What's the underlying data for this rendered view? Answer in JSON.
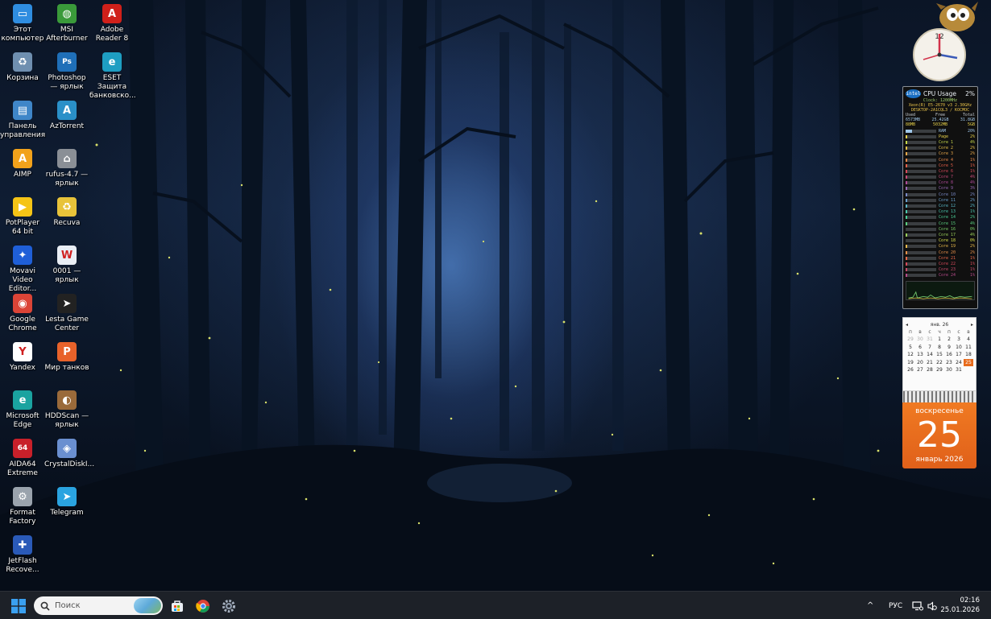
{
  "desktop": {
    "col1": [
      {
        "label": "Этот компьютер",
        "icon": "computer-icon",
        "color": "#2f8de0"
      },
      {
        "label": "Корзина",
        "icon": "recycle-bin-icon",
        "color": "#6f8fb0"
      },
      {
        "label": "Панель управления",
        "icon": "control-panel-icon",
        "color": "#3f86c8"
      },
      {
        "label": "AIMP",
        "icon": "aimp-icon",
        "color": "#f2a21b"
      },
      {
        "label": "PotPlayer 64 bit",
        "icon": "potplayer-icon",
        "color": "#f5c416"
      },
      {
        "label": "Movavi Video Editor...",
        "icon": "movavi-icon",
        "color": "#1f5fd8"
      },
      {
        "label": "Google Chrome",
        "icon": "chrome-icon",
        "color": "#db4437"
      },
      {
        "label": "Yandex",
        "icon": "yandex-icon",
        "color": "#ffffff"
      },
      {
        "label": "Microsoft Edge",
        "icon": "edge-icon",
        "color": "#1aa3a0"
      },
      {
        "label": "AIDA64 Extreme",
        "icon": "aida64-icon",
        "color": "#c8202a"
      },
      {
        "label": "Format Factory",
        "icon": "format-factory-icon",
        "color": "#9aa3ad"
      },
      {
        "label": "JetFlash Recove...",
        "icon": "jetflash-icon",
        "color": "#2a5ab8"
      }
    ],
    "col2": [
      {
        "label": "MSI Afterburner",
        "icon": "msi-afterburner-icon",
        "color": "#3a9a3a"
      },
      {
        "label": "Photoshop — ярлык",
        "icon": "photoshop-icon",
        "color": "#1f6fb8"
      },
      {
        "label": "AzTorrent",
        "icon": "aztorrent-icon",
        "color": "#2a90c8"
      },
      {
        "label": "rufus-4.7 — ярлык",
        "icon": "rufus-icon",
        "color": "#8a8f96"
      },
      {
        "label": "Recuva",
        "icon": "recuva-icon",
        "color": "#e8c33a"
      },
      {
        "label": "0001 — ярлык",
        "icon": "word-document-icon",
        "color": "#e9eef5"
      },
      {
        "label": "Lesta Game Center",
        "icon": "lesta-icon",
        "color": "#222222"
      },
      {
        "label": "Мир танков",
        "icon": "mir-tankov-icon",
        "color": "#e8622a"
      },
      {
        "label": "HDDScan — ярлык",
        "icon": "hddscan-icon",
        "color": "#9a6a3a"
      },
      {
        "label": "CrystalDiskI...",
        "icon": "crystaldisk-icon",
        "color": "#6a8fd0"
      },
      {
        "label": "Telegram",
        "icon": "telegram-icon",
        "color": "#2aa3e0"
      }
    ],
    "col3": [
      {
        "label": "Adobe Reader 8",
        "icon": "adobe-reader-icon",
        "color": "#d0201a"
      },
      {
        "label": "ESET Защита банковско...",
        "icon": "eset-icon",
        "color": "#1e9ec2"
      }
    ]
  },
  "clock_gadget": {
    "numeral": "12",
    "time": "02:16"
  },
  "cpu_gadget": {
    "title": "CPU Usage",
    "percent": "2%",
    "clock": "Clock: 1200MHz",
    "cpu_name": "Xeon(R) E5-2670 v3 2.30GHz",
    "host": "DESKTOP-2A1CQL3 / KOCMOC",
    "mem_headers": [
      "Used",
      "Free",
      "Total"
    ],
    "mem_row1": [
      "6573MB",
      "25.42GB",
      "31.8GB"
    ],
    "mem_row2": [
      "88MB",
      "5032MB",
      "5GB"
    ],
    "rows": [
      {
        "name": "RAM",
        "value": "20%",
        "fill": 0.2,
        "color": "#9fc6e8"
      },
      {
        "name": "Page",
        "value": "2%",
        "fill": 0.02,
        "color": "#e8d24a"
      },
      {
        "name": "Core 1",
        "value": "4%",
        "fill": 0.04,
        "color": "#c6d84a"
      },
      {
        "name": "Core 2",
        "value": "2%",
        "fill": 0.02,
        "color": "#e8c24a"
      },
      {
        "name": "Core 3",
        "value": "2%",
        "fill": 0.02,
        "color": "#e8a84a"
      },
      {
        "name": "Core 4",
        "value": "1%",
        "fill": 0.01,
        "color": "#e8884a"
      },
      {
        "name": "Core 5",
        "value": "1%",
        "fill": 0.01,
        "color": "#e8604a"
      },
      {
        "name": "Core 6",
        "value": "1%",
        "fill": 0.01,
        "color": "#d84a5a"
      },
      {
        "name": "Core 7",
        "value": "4%",
        "fill": 0.04,
        "color": "#c84a7a"
      },
      {
        "name": "Core 8",
        "value": "4%",
        "fill": 0.04,
        "color": "#b04a9a"
      },
      {
        "name": "Core 9",
        "value": "3%",
        "fill": 0.03,
        "color": "#9a6ab8"
      },
      {
        "name": "Core 10",
        "value": "2%",
        "fill": 0.02,
        "color": "#7a8ac8"
      },
      {
        "name": "Core 11",
        "value": "2%",
        "fill": 0.02,
        "color": "#6aa0d0"
      },
      {
        "name": "Core 12",
        "value": "2%",
        "fill": 0.02,
        "color": "#5ab8c8"
      },
      {
        "name": "Core 13",
        "value": "1%",
        "fill": 0.01,
        "color": "#4ac8b0"
      },
      {
        "name": "Core 14",
        "value": "2%",
        "fill": 0.02,
        "color": "#4ad098"
      },
      {
        "name": "Core 15",
        "value": "4%",
        "fill": 0.04,
        "color": "#5ad080"
      },
      {
        "name": "Core 16",
        "value": "0%",
        "fill": 0.0,
        "color": "#7ad06a"
      },
      {
        "name": "Core 17",
        "value": "4%",
        "fill": 0.04,
        "color": "#9ad05a"
      },
      {
        "name": "Core 18",
        "value": "0%",
        "fill": 0.0,
        "color": "#d8e04a"
      },
      {
        "name": "Core 19",
        "value": "2%",
        "fill": 0.02,
        "color": "#e8b84a"
      },
      {
        "name": "Core 20",
        "value": "2%",
        "fill": 0.02,
        "color": "#e8904a"
      },
      {
        "name": "Core 21",
        "value": "1%",
        "fill": 0.01,
        "color": "#e8684a"
      },
      {
        "name": "Core 22",
        "value": "1%",
        "fill": 0.01,
        "color": "#d84a5a"
      },
      {
        "name": "Core 23",
        "value": "1%",
        "fill": 0.01,
        "color": "#c84a6a"
      },
      {
        "name": "Core 24",
        "value": "1%",
        "fill": 0.01,
        "color": "#b84a8a"
      }
    ]
  },
  "calendar": {
    "month_header": "янв. 26",
    "prev": "◂",
    "next": "▸",
    "dow": [
      "п",
      "в",
      "с",
      "ч",
      "п",
      "с",
      "в"
    ],
    "days": [
      {
        "d": "29",
        "dim": true
      },
      {
        "d": "30",
        "dim": true
      },
      {
        "d": "31",
        "dim": true
      },
      {
        "d": "1"
      },
      {
        "d": "2"
      },
      {
        "d": "3"
      },
      {
        "d": "4"
      },
      {
        "d": "5"
      },
      {
        "d": "6"
      },
      {
        "d": "7"
      },
      {
        "d": "8"
      },
      {
        "d": "9"
      },
      {
        "d": "10"
      },
      {
        "d": "11"
      },
      {
        "d": "12"
      },
      {
        "d": "13"
      },
      {
        "d": "14"
      },
      {
        "d": "15"
      },
      {
        "d": "16"
      },
      {
        "d": "17"
      },
      {
        "d": "18"
      },
      {
        "d": "19"
      },
      {
        "d": "20"
      },
      {
        "d": "21"
      },
      {
        "d": "22"
      },
      {
        "d": "23"
      },
      {
        "d": "24"
      },
      {
        "d": "25",
        "today": true
      },
      {
        "d": "26"
      },
      {
        "d": "27"
      },
      {
        "d": "28"
      },
      {
        "d": "29"
      },
      {
        "d": "30"
      },
      {
        "d": "31"
      },
      {
        "d": ""
      }
    ],
    "weekday": "воскресенье",
    "day": "25",
    "month_year": "январь 2026"
  },
  "taskbar": {
    "start_icon": "windows-start-icon",
    "search_placeholder": "Поиск",
    "pinned": [
      "store-icon",
      "chrome-icon",
      "settings-gear-icon"
    ],
    "tray": {
      "chevron": "^",
      "language": "РУС",
      "time": "02:16",
      "date": "25.01.2026"
    }
  },
  "colors": {
    "taskbar_bg": "#1d2128",
    "accent_orange": "#e86b1c",
    "windows_blue": "#3aa0f0"
  }
}
